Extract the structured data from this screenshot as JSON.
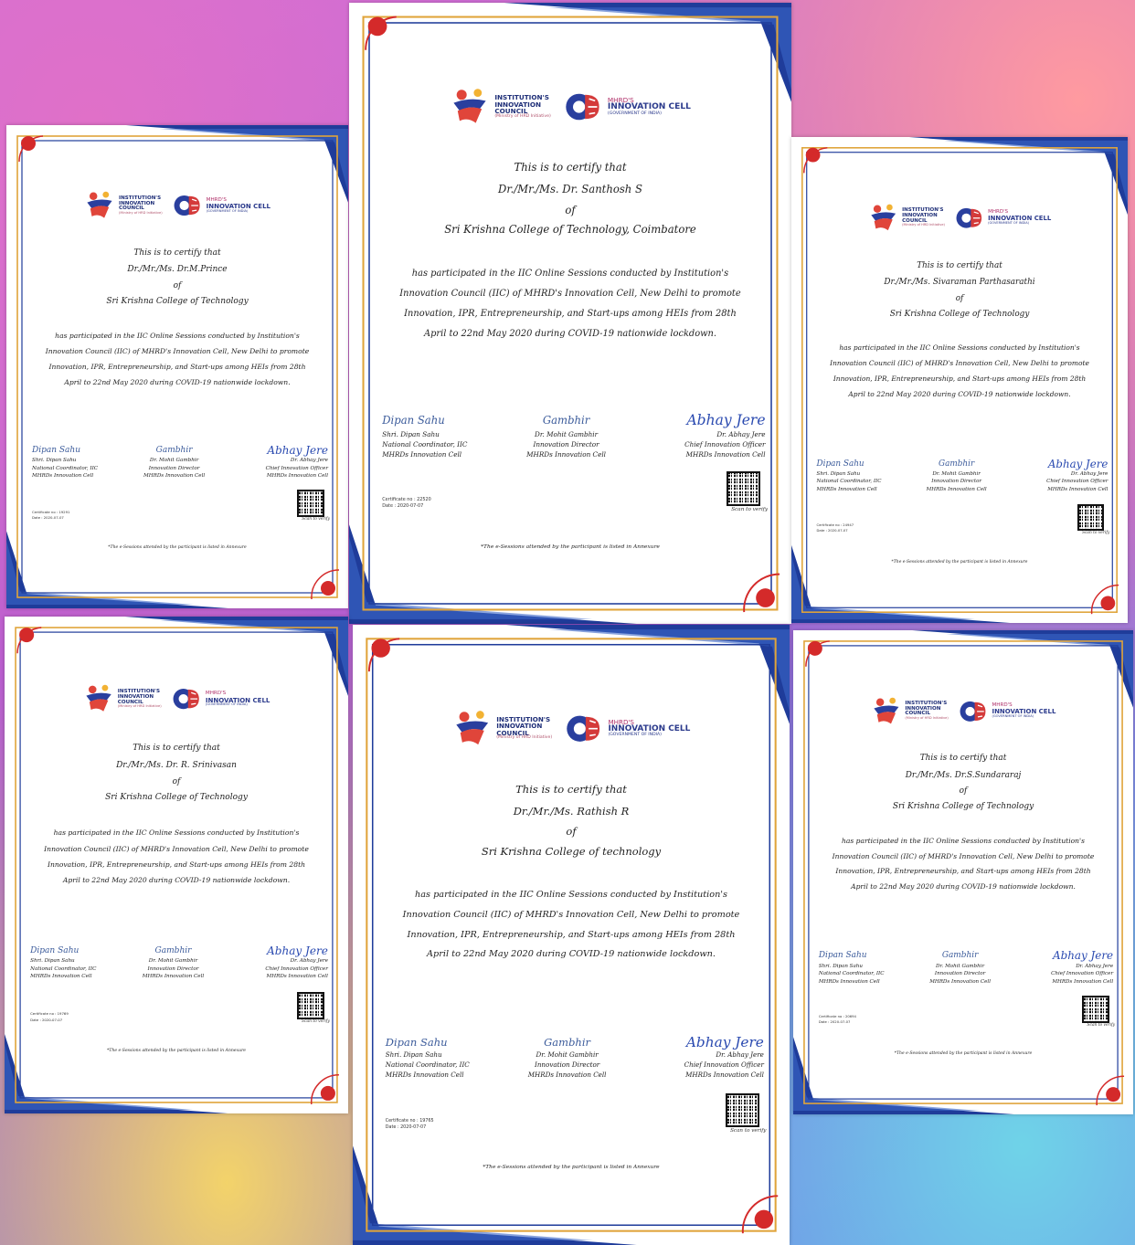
{
  "colors": {
    "navy": "#1f3c9a",
    "gold": "#e0a43a",
    "red": "#d42a2a"
  },
  "common": {
    "certify": "This is to certify that",
    "of": "of",
    "body_lines": [
      "has participated in the IIC Online Sessions conducted by Institution's",
      "Innovation Council (IIC) of MHRD's Innovation Cell, New Delhi to promote",
      "Innovation, IPR, Entrepreneurship, and Start-ups among HEIs from 28th",
      "April to 22nd May 2020 during COVID-19 nationwide lockdown."
    ],
    "logo1": {
      "line1": "INSTITUTION'S",
      "line2": "INNOVATION",
      "line3": "COUNCIL",
      "sub": "(Ministry of HRD Initiative)"
    },
    "logo2": {
      "line1": "MHRD'S",
      "line2": "INNOVATION CELL",
      "sub": "(GOVERNMENT OF INDIA)"
    },
    "signatories": [
      {
        "hand": "Dipan Sahu",
        "name": "Shri. Dipan Sahu",
        "role": "National Coordinator, IIC",
        "org": "MHRDs Innovation Cell"
      },
      {
        "hand": "Gambhir",
        "name": "Dr. Mohit Gambhir",
        "role": "Innovation Director",
        "org": "MHRDs Innovation Cell"
      },
      {
        "hand": "Abhay Jere",
        "name": "Dr. Abhay Jere",
        "role": "Chief Innovation Officer",
        "org": "MHRDs Innovation Cell"
      }
    ],
    "scan": "Scan to verify",
    "footnote": "*The e-Sessions attended by the participant is listed in Annexure"
  },
  "certificates": [
    {
      "name_line": "Dr./Mr./Ms. Dr.M.Prince",
      "college": "Sri Krishna College of Technology",
      "cert_no": "Certificate no : 19291",
      "date": "Date : 2020-07-07"
    },
    {
      "name_line": "Dr./Mr./Ms. Dr. Santhosh S",
      "college": "Sri Krishna College of Technology, Coimbatore",
      "cert_no": "Certificate no : 22520",
      "date": "Date : 2020-07-07"
    },
    {
      "name_line": "Dr./Mr./Ms. Sivaraman Parthasarathi",
      "college": "Sri Krishna College of Technology",
      "cert_no": "Certificate no : 24947",
      "date": "Date : 2020-07-07"
    },
    {
      "name_line": "Dr./Mr./Ms. Dr. R. Srinivasan",
      "college": "Sri Krishna College of Technology",
      "cert_no": "Certificate no : 19769",
      "date": "Date : 2020-07-07"
    },
    {
      "name_line": "Dr./Mr./Ms. Rathish R",
      "college": "Sri Krishna College of technology",
      "cert_no": "Certificate no : 19765",
      "date": "Date : 2020-07-07"
    },
    {
      "name_line": "Dr./Mr./Ms. Dr.S.Sundararaj",
      "college": "Sri Krishna College of Technology",
      "cert_no": "Certificate no : 20694",
      "date": "Date : 2020-07-07"
    }
  ]
}
